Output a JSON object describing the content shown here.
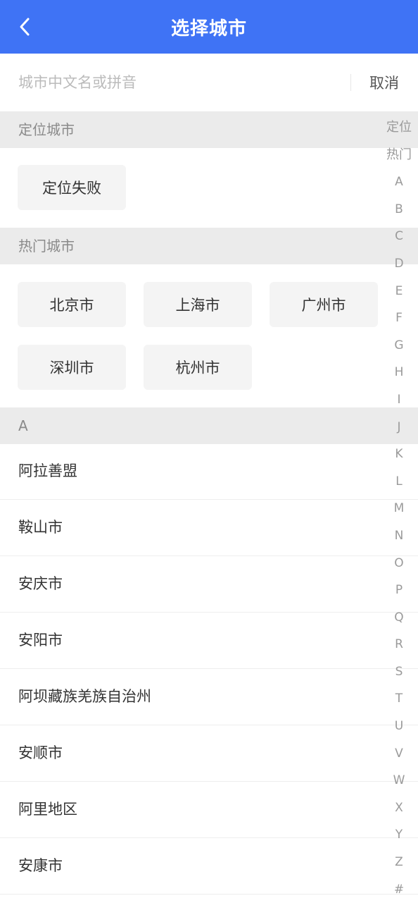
{
  "header": {
    "title": "选择城市"
  },
  "search": {
    "placeholder": "城市中文名或拼音",
    "value": "",
    "cancel_label": "取消"
  },
  "located": {
    "section_title": "定位城市",
    "status": "定位失败"
  },
  "hot": {
    "section_title": "热门城市",
    "cities": [
      "北京市",
      "上海市",
      "广州市",
      "深圳市",
      "杭州市"
    ]
  },
  "list": {
    "section_letter": "A",
    "cities": [
      "阿拉善盟",
      "鞍山市",
      "安庆市",
      "安阳市",
      "阿坝藏族羌族自治州",
      "安顺市",
      "阿里地区",
      "安康市"
    ]
  },
  "index": [
    "定位",
    "热门",
    "A",
    "B",
    "C",
    "D",
    "E",
    "F",
    "G",
    "H",
    "I",
    "J",
    "K",
    "L",
    "M",
    "N",
    "O",
    "P",
    "Q",
    "R",
    "S",
    "T",
    "U",
    "V",
    "W",
    "X",
    "Y",
    "Z",
    "#"
  ],
  "colors": {
    "accent": "#3f73f5",
    "section_bg": "#ebebeb",
    "chip_bg": "#f4f4f4"
  }
}
